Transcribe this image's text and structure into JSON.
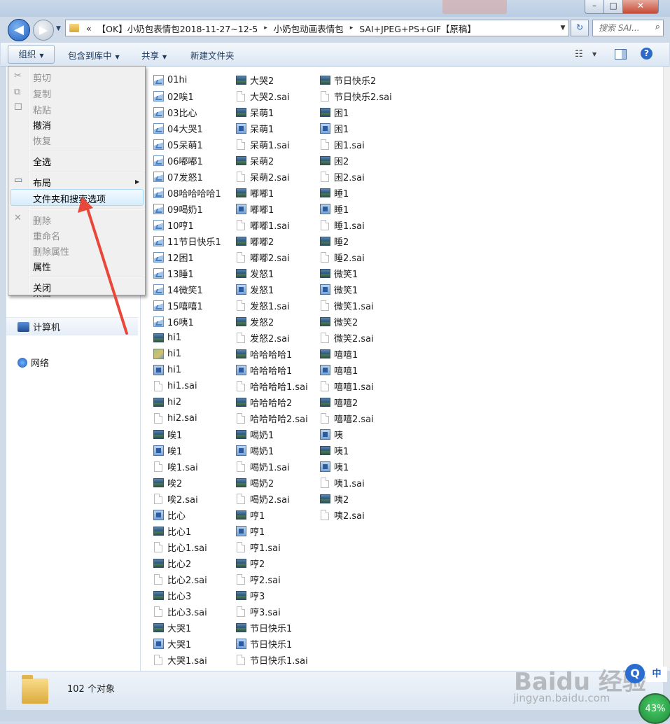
{
  "window": {
    "minimize_glyph": "–",
    "maximize_glyph": "□",
    "close_glyph": "✕"
  },
  "nav": {
    "back_glyph": "◀",
    "forward_glyph": "▶",
    "history_glyph": "▼"
  },
  "address": {
    "overflow": "«",
    "crumbs": [
      "【OK】小奶包表情包2018-11-27~12-5",
      "小奶包动画表情包",
      "SAI+JPEG+PS+GIF【原稿】"
    ],
    "separator": "▸",
    "dropdown_glyph": "▼",
    "refresh_glyph": "↻"
  },
  "search": {
    "placeholder": "搜索 SAI...",
    "icon_glyph": "⌕"
  },
  "toolbar": {
    "organize": "组织",
    "include_in_library": "包含到库中",
    "share": "共享",
    "new_folder": "新建文件夹",
    "dropdown_glyph": "▼",
    "view_glyph": "☷",
    "help_glyph": "?"
  },
  "context_menu": {
    "items": [
      {
        "label": "剪切",
        "enabled": false,
        "icon": "✂"
      },
      {
        "label": "复制",
        "enabled": false,
        "icon": "⧉"
      },
      {
        "label": "粘贴",
        "enabled": false,
        "icon": "☐"
      },
      {
        "label": "撤消",
        "enabled": true
      },
      {
        "label": "恢复",
        "enabled": false
      },
      {
        "label": "全选",
        "enabled": true
      },
      {
        "label": "布局",
        "enabled": true,
        "submenu": true,
        "icon": "▭"
      },
      {
        "label": "文件夹和搜索选项",
        "enabled": true,
        "highlighted": true
      },
      {
        "label": "删除",
        "enabled": false,
        "icon": "✕"
      },
      {
        "label": "重命名",
        "enabled": false
      },
      {
        "label": "删除属性",
        "enabled": false
      },
      {
        "label": "属性",
        "enabled": true
      },
      {
        "label": "关闭",
        "enabled": true
      }
    ],
    "submenu_glyph": "▶"
  },
  "nav_pane": {
    "partial_item": "桌面",
    "items": [
      {
        "label": "计算机",
        "icon": "computer-icon"
      },
      {
        "label": "网络",
        "icon": "network-icon"
      }
    ]
  },
  "files": {
    "columns": [
      [
        {
          "name": "01hi",
          "type": "gif"
        },
        {
          "name": "02唉1",
          "type": "gif"
        },
        {
          "name": "03比心",
          "type": "gif"
        },
        {
          "name": "04大哭1",
          "type": "gif"
        },
        {
          "name": "05呆萌1",
          "type": "gif"
        },
        {
          "name": "06嘟嘟1",
          "type": "gif"
        },
        {
          "name": "07发怒1",
          "type": "gif"
        },
        {
          "name": "08哈哈哈哈1",
          "type": "gif"
        },
        {
          "name": "09喝奶1",
          "type": "gif"
        },
        {
          "name": "10哼1",
          "type": "gif"
        },
        {
          "name": "11节日快乐1",
          "type": "gif"
        },
        {
          "name": "12困1",
          "type": "gif"
        },
        {
          "name": "13睡1",
          "type": "gif"
        },
        {
          "name": "14微笑1",
          "type": "gif"
        },
        {
          "name": "15嘻嘻1",
          "type": "gif"
        },
        {
          "name": "16咦1",
          "type": "gif"
        },
        {
          "name": "hi1",
          "type": "img"
        },
        {
          "name": "hi1",
          "type": "thumb"
        },
        {
          "name": "hi1",
          "type": "jpg"
        },
        {
          "name": "hi1.sai",
          "type": "doc"
        },
        {
          "name": "hi2",
          "type": "img"
        },
        {
          "name": "hi2.sai",
          "type": "doc"
        },
        {
          "name": "唉1",
          "type": "img"
        },
        {
          "name": "唉1",
          "type": "jpg"
        },
        {
          "name": "唉1.sai",
          "type": "doc"
        },
        {
          "name": "唉2",
          "type": "img"
        },
        {
          "name": "唉2.sai",
          "type": "doc"
        },
        {
          "name": "比心",
          "type": "jpg"
        },
        {
          "name": "比心1",
          "type": "img"
        },
        {
          "name": "比心1.sai",
          "type": "doc"
        },
        {
          "name": "比心2",
          "type": "img"
        },
        {
          "name": "比心2.sai",
          "type": "doc"
        },
        {
          "name": "比心3",
          "type": "img"
        },
        {
          "name": "比心3.sai",
          "type": "doc"
        },
        {
          "name": "大哭1",
          "type": "img"
        },
        {
          "name": "大哭1",
          "type": "jpg"
        },
        {
          "name": "大哭1.sai",
          "type": "doc"
        }
      ],
      [
        {
          "name": "大哭2",
          "type": "img"
        },
        {
          "name": "大哭2.sai",
          "type": "doc"
        },
        {
          "name": "呆萌1",
          "type": "img"
        },
        {
          "name": "呆萌1",
          "type": "jpg"
        },
        {
          "name": "呆萌1.sai",
          "type": "doc"
        },
        {
          "name": "呆萌2",
          "type": "img"
        },
        {
          "name": "呆萌2.sai",
          "type": "doc"
        },
        {
          "name": "嘟嘟1",
          "type": "img"
        },
        {
          "name": "嘟嘟1",
          "type": "jpg"
        },
        {
          "name": "嘟嘟1.sai",
          "type": "doc"
        },
        {
          "name": "嘟嘟2",
          "type": "img"
        },
        {
          "name": "嘟嘟2.sai",
          "type": "doc"
        },
        {
          "name": "发怒1",
          "type": "img"
        },
        {
          "name": "发怒1",
          "type": "jpg"
        },
        {
          "name": "发怒1.sai",
          "type": "doc"
        },
        {
          "name": "发怒2",
          "type": "img"
        },
        {
          "name": "发怒2.sai",
          "type": "doc"
        },
        {
          "name": "哈哈哈哈1",
          "type": "img"
        },
        {
          "name": "哈哈哈哈1",
          "type": "jpg"
        },
        {
          "name": "哈哈哈哈1.sai",
          "type": "doc"
        },
        {
          "name": "哈哈哈哈2",
          "type": "img"
        },
        {
          "name": "哈哈哈哈2.sai",
          "type": "doc"
        },
        {
          "name": "喝奶1",
          "type": "img"
        },
        {
          "name": "喝奶1",
          "type": "jpg"
        },
        {
          "name": "喝奶1.sai",
          "type": "doc"
        },
        {
          "name": "喝奶2",
          "type": "img"
        },
        {
          "name": "喝奶2.sai",
          "type": "doc"
        },
        {
          "name": "哼1",
          "type": "img"
        },
        {
          "name": "哼1",
          "type": "jpg"
        },
        {
          "name": "哼1.sai",
          "type": "doc"
        },
        {
          "name": "哼2",
          "type": "img"
        },
        {
          "name": "哼2.sai",
          "type": "doc"
        },
        {
          "name": "哼3",
          "type": "img"
        },
        {
          "name": "哼3.sai",
          "type": "doc"
        },
        {
          "name": "节日快乐1",
          "type": "img"
        },
        {
          "name": "节日快乐1",
          "type": "jpg"
        },
        {
          "name": "节日快乐1.sai",
          "type": "doc"
        }
      ],
      [
        {
          "name": "节日快乐2",
          "type": "img"
        },
        {
          "name": "节日快乐2.sai",
          "type": "doc"
        },
        {
          "name": "困1",
          "type": "img"
        },
        {
          "name": "困1",
          "type": "jpg"
        },
        {
          "name": "困1.sai",
          "type": "doc"
        },
        {
          "name": "困2",
          "type": "img"
        },
        {
          "name": "困2.sai",
          "type": "doc"
        },
        {
          "name": "睡1",
          "type": "img"
        },
        {
          "name": "睡1",
          "type": "jpg"
        },
        {
          "name": "睡1.sai",
          "type": "doc"
        },
        {
          "name": "睡2",
          "type": "img"
        },
        {
          "name": "睡2.sai",
          "type": "doc"
        },
        {
          "name": "微笑1",
          "type": "img"
        },
        {
          "name": "微笑1",
          "type": "jpg"
        },
        {
          "name": "微笑1.sai",
          "type": "doc"
        },
        {
          "name": "微笑2",
          "type": "img"
        },
        {
          "name": "微笑2.sai",
          "type": "doc"
        },
        {
          "name": "嘻嘻1",
          "type": "img"
        },
        {
          "name": "嘻嘻1",
          "type": "jpg"
        },
        {
          "name": "嘻嘻1.sai",
          "type": "doc"
        },
        {
          "name": "嘻嘻2",
          "type": "img"
        },
        {
          "name": "嘻嘻2.sai",
          "type": "doc"
        },
        {
          "name": "咦",
          "type": "jpg"
        },
        {
          "name": "咦1",
          "type": "img"
        },
        {
          "name": "咦1",
          "type": "jpg"
        },
        {
          "name": "咦1.sai",
          "type": "doc"
        },
        {
          "name": "咦2",
          "type": "img"
        },
        {
          "name": "咦2.sai",
          "type": "doc"
        }
      ]
    ]
  },
  "status": {
    "count_text": "102 个对象"
  },
  "overlay": {
    "watermark": "Baidu 经验",
    "watermark_url": "jingyan.baidu.com",
    "ime_icon": "Q",
    "ime_lang": "中",
    "percent": "43%",
    "arrow_color": "#e8473a"
  }
}
